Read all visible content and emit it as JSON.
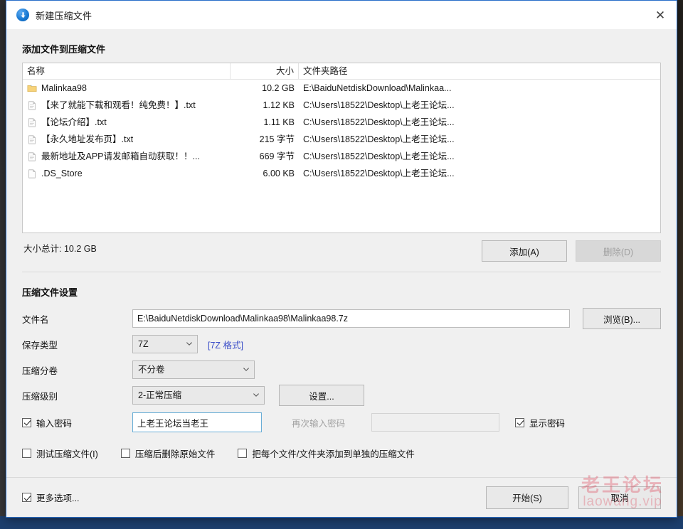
{
  "window": {
    "title": "新建压缩文件",
    "app_icon": "archive-circle-icon",
    "close_label": "✕",
    "accent_color": "#2a6fc9"
  },
  "add_section": {
    "heading": "添加文件到压缩文件",
    "columns": [
      "名称",
      "大小",
      "文件夹路径"
    ],
    "rows": [
      {
        "icon": "folder-icon",
        "name": "Malinkaa98",
        "size": "10.2 GB",
        "path": "E:\\BaiduNetdiskDownload\\Malinkaa..."
      },
      {
        "icon": "text-file-icon",
        "name": "【来了就能下载和观看！纯免费！】.txt",
        "size": "1.12 KB",
        "path": "C:\\Users\\18522\\Desktop\\上老王论坛..."
      },
      {
        "icon": "text-file-icon",
        "name": "【论坛介绍】.txt",
        "size": "1.11 KB",
        "path": "C:\\Users\\18522\\Desktop\\上老王论坛..."
      },
      {
        "icon": "text-file-icon",
        "name": "【永久地址发布页】.txt",
        "size": "215 字节",
        "path": "C:\\Users\\18522\\Desktop\\上老王论坛..."
      },
      {
        "icon": "text-file-icon",
        "name": "最新地址及APP请发邮箱自动获取！！...",
        "size": "669 字节",
        "path": "C:\\Users\\18522\\Desktop\\上老王论坛..."
      },
      {
        "icon": "blank-file-icon",
        "name": ".DS_Store",
        "size": "6.00 KB",
        "path": "C:\\Users\\18522\\Desktop\\上老王论坛..."
      }
    ],
    "total_label": "大小总计: 10.2 GB",
    "add_button": "添加(A)",
    "delete_button": "删除(D)"
  },
  "settings": {
    "heading": "压缩文件设置",
    "filename_label": "文件名",
    "filename_value": "E:\\BaiduNetdiskDownload\\Malinkaa98\\Malinkaa98.7z",
    "filename_placeholder": "",
    "browse_button": "浏览(B)...",
    "savetype_label": "保存类型",
    "savetype_value": "7Z",
    "format_link": "[7Z 格式]",
    "split_label": "压缩分卷",
    "split_value": "不分卷",
    "level_label": "压缩级别",
    "level_value": "2-正常压缩",
    "settings_button": "设置...",
    "password_label": "输入密码",
    "password_checked": true,
    "password_value": "上老王论坛当老王",
    "password_placeholder": "",
    "confirm_password_label": "再次输入密码",
    "confirm_password_value": "",
    "confirm_password_placeholder": "",
    "show_password_label": "显示密码",
    "show_password_checked": true
  },
  "options": {
    "test_archive_label": "测试压缩文件(I)",
    "test_archive_checked": false,
    "delete_after_label": "压缩后删除原始文件",
    "delete_after_checked": false,
    "separate_archives_label": "把每个文件/文件夹添加到单独的压缩文件",
    "separate_archives_checked": false,
    "more_options_label": "更多选项...",
    "more_options_checked": true
  },
  "footer": {
    "start_button": "开始(S)",
    "cancel_button": "取消"
  },
  "watermark": {
    "line1": "老王论坛",
    "line2": "laowang.vip",
    "color": "#e06070"
  }
}
